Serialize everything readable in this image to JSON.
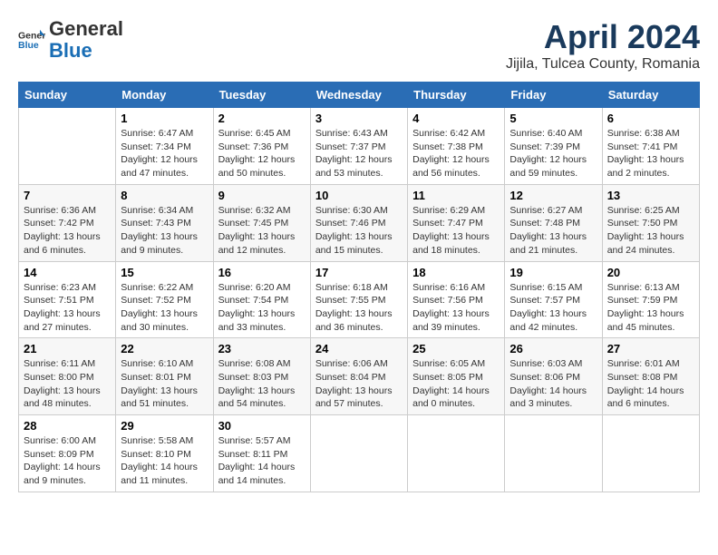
{
  "header": {
    "logo_general": "General",
    "logo_blue": "Blue",
    "month_title": "April 2024",
    "location": "Jijila, Tulcea County, Romania"
  },
  "weekdays": [
    "Sunday",
    "Monday",
    "Tuesday",
    "Wednesday",
    "Thursday",
    "Friday",
    "Saturday"
  ],
  "weeks": [
    [
      {
        "day": "",
        "detail": ""
      },
      {
        "day": "1",
        "detail": "Sunrise: 6:47 AM\nSunset: 7:34 PM\nDaylight: 12 hours\nand 47 minutes."
      },
      {
        "day": "2",
        "detail": "Sunrise: 6:45 AM\nSunset: 7:36 PM\nDaylight: 12 hours\nand 50 minutes."
      },
      {
        "day": "3",
        "detail": "Sunrise: 6:43 AM\nSunset: 7:37 PM\nDaylight: 12 hours\nand 53 minutes."
      },
      {
        "day": "4",
        "detail": "Sunrise: 6:42 AM\nSunset: 7:38 PM\nDaylight: 12 hours\nand 56 minutes."
      },
      {
        "day": "5",
        "detail": "Sunrise: 6:40 AM\nSunset: 7:39 PM\nDaylight: 12 hours\nand 59 minutes."
      },
      {
        "day": "6",
        "detail": "Sunrise: 6:38 AM\nSunset: 7:41 PM\nDaylight: 13 hours\nand 2 minutes."
      }
    ],
    [
      {
        "day": "7",
        "detail": "Sunrise: 6:36 AM\nSunset: 7:42 PM\nDaylight: 13 hours\nand 6 minutes."
      },
      {
        "day": "8",
        "detail": "Sunrise: 6:34 AM\nSunset: 7:43 PM\nDaylight: 13 hours\nand 9 minutes."
      },
      {
        "day": "9",
        "detail": "Sunrise: 6:32 AM\nSunset: 7:45 PM\nDaylight: 13 hours\nand 12 minutes."
      },
      {
        "day": "10",
        "detail": "Sunrise: 6:30 AM\nSunset: 7:46 PM\nDaylight: 13 hours\nand 15 minutes."
      },
      {
        "day": "11",
        "detail": "Sunrise: 6:29 AM\nSunset: 7:47 PM\nDaylight: 13 hours\nand 18 minutes."
      },
      {
        "day": "12",
        "detail": "Sunrise: 6:27 AM\nSunset: 7:48 PM\nDaylight: 13 hours\nand 21 minutes."
      },
      {
        "day": "13",
        "detail": "Sunrise: 6:25 AM\nSunset: 7:50 PM\nDaylight: 13 hours\nand 24 minutes."
      }
    ],
    [
      {
        "day": "14",
        "detail": "Sunrise: 6:23 AM\nSunset: 7:51 PM\nDaylight: 13 hours\nand 27 minutes."
      },
      {
        "day": "15",
        "detail": "Sunrise: 6:22 AM\nSunset: 7:52 PM\nDaylight: 13 hours\nand 30 minutes."
      },
      {
        "day": "16",
        "detail": "Sunrise: 6:20 AM\nSunset: 7:54 PM\nDaylight: 13 hours\nand 33 minutes."
      },
      {
        "day": "17",
        "detail": "Sunrise: 6:18 AM\nSunset: 7:55 PM\nDaylight: 13 hours\nand 36 minutes."
      },
      {
        "day": "18",
        "detail": "Sunrise: 6:16 AM\nSunset: 7:56 PM\nDaylight: 13 hours\nand 39 minutes."
      },
      {
        "day": "19",
        "detail": "Sunrise: 6:15 AM\nSunset: 7:57 PM\nDaylight: 13 hours\nand 42 minutes."
      },
      {
        "day": "20",
        "detail": "Sunrise: 6:13 AM\nSunset: 7:59 PM\nDaylight: 13 hours\nand 45 minutes."
      }
    ],
    [
      {
        "day": "21",
        "detail": "Sunrise: 6:11 AM\nSunset: 8:00 PM\nDaylight: 13 hours\nand 48 minutes."
      },
      {
        "day": "22",
        "detail": "Sunrise: 6:10 AM\nSunset: 8:01 PM\nDaylight: 13 hours\nand 51 minutes."
      },
      {
        "day": "23",
        "detail": "Sunrise: 6:08 AM\nSunset: 8:03 PM\nDaylight: 13 hours\nand 54 minutes."
      },
      {
        "day": "24",
        "detail": "Sunrise: 6:06 AM\nSunset: 8:04 PM\nDaylight: 13 hours\nand 57 minutes."
      },
      {
        "day": "25",
        "detail": "Sunrise: 6:05 AM\nSunset: 8:05 PM\nDaylight: 14 hours\nand 0 minutes."
      },
      {
        "day": "26",
        "detail": "Sunrise: 6:03 AM\nSunset: 8:06 PM\nDaylight: 14 hours\nand 3 minutes."
      },
      {
        "day": "27",
        "detail": "Sunrise: 6:01 AM\nSunset: 8:08 PM\nDaylight: 14 hours\nand 6 minutes."
      }
    ],
    [
      {
        "day": "28",
        "detail": "Sunrise: 6:00 AM\nSunset: 8:09 PM\nDaylight: 14 hours\nand 9 minutes."
      },
      {
        "day": "29",
        "detail": "Sunrise: 5:58 AM\nSunset: 8:10 PM\nDaylight: 14 hours\nand 11 minutes."
      },
      {
        "day": "30",
        "detail": "Sunrise: 5:57 AM\nSunset: 8:11 PM\nDaylight: 14 hours\nand 14 minutes."
      },
      {
        "day": "",
        "detail": ""
      },
      {
        "day": "",
        "detail": ""
      },
      {
        "day": "",
        "detail": ""
      },
      {
        "day": "",
        "detail": ""
      }
    ]
  ]
}
